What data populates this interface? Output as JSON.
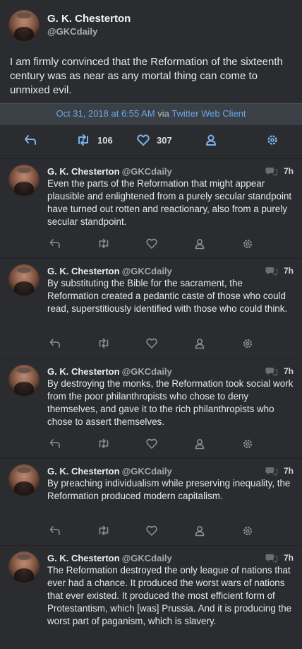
{
  "main_tweet": {
    "name": "G. K. Chesterton",
    "handle": "@GKCdaily",
    "text": "I am firmly convinced that the Reformation of the sixteenth century was as near as any mortal thing can come to unmixed evil.",
    "timestamp": "Oct 31, 2018 at 6:55 AM",
    "via": "via",
    "client": "Twitter Web Client",
    "retweets": "106",
    "likes": "307"
  },
  "timeline": [
    {
      "name": "G. K. Chesterton",
      "handle": "@GKCdaily",
      "time": "7h",
      "text": "Even the parts of the Reformation that might appear plausible and enlightened from a purely secular standpoint have turned out rotten and reactionary, also from a purely secular standpoint."
    },
    {
      "name": "G. K. Chesterton",
      "handle": "@GKCdaily",
      "time": "7h",
      "text": "By substituting the Bible for the sacrament, the Reformation created a pedantic caste of those who could read, superstitiously identified with those who could think."
    },
    {
      "name": "G. K. Chesterton",
      "handle": "@GKCdaily",
      "time": "7h",
      "text": "By destroying the monks, the Reformation took social work from the poor philanthropists who chose to deny themselves, and gave it to the rich philanthropists who chose to assert themselves."
    },
    {
      "name": "G. K. Chesterton",
      "handle": "@GKCdaily",
      "time": "7h",
      "text": "By preaching individualism while preserving inequality, the Reformation produced modern capitalism."
    },
    {
      "name": "G. K. Chesterton",
      "handle": "@GKCdaily",
      "time": "7h",
      "text": "The Reformation destroyed the only league of nations that ever had a chance. It produced the worst wars of nations that ever existed. It produced the most efficient form of Protestantism, which [was] Prussia. And it is producing the worst part of paganism, which is slavery."
    }
  ],
  "colors": {
    "background": "#2a2c2f",
    "accent": "#7ab3ee",
    "meta_bar": "#3b3f46",
    "muted_icon": "#8a8e94"
  },
  "icons": [
    "reply-icon",
    "retweet-icon",
    "like-icon",
    "user-icon",
    "gear-icon",
    "conversation-icon"
  ]
}
